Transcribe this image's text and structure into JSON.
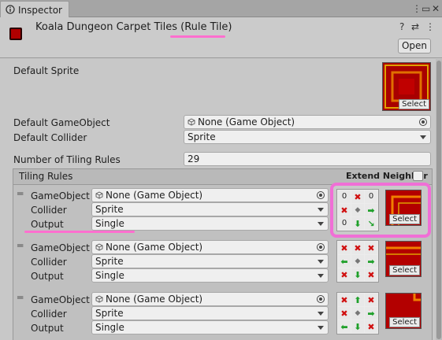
{
  "tab": {
    "label": "Inspector",
    "icon": "info-icon"
  },
  "window_controls": {
    "menu_icon": "kebab-menu-icon",
    "maximize_icon": "maximize-icon",
    "close_icon": "close-icon"
  },
  "header": {
    "title": "Koala Dungeon Carpet Tiles",
    "type_suffix": "(Rule Tile)",
    "open_label": "Open",
    "icons": [
      "help-icon",
      "preset-icon",
      "more-options-icon"
    ]
  },
  "fields": {
    "default_sprite_label": "Default Sprite",
    "default_sprite_select": "Select",
    "default_gameobject_label": "Default GameObject",
    "default_gameobject_value": "None (Game Object)",
    "default_collider_label": "Default Collider",
    "default_collider_value": "Sprite",
    "num_tiling_rules_label": "Number of Tiling Rules",
    "num_tiling_rules_value": "29"
  },
  "tiling_rules": {
    "title": "Tiling Rules",
    "extend_neighbor_label": "Extend Neighbor",
    "extend_neighbor_checked": false,
    "rules": [
      {
        "gameobject_label": "GameObject",
        "gameobject_value": "None (Game Object)",
        "collider_label": "Collider",
        "collider_value": "Sprite",
        "output_label": "Output",
        "output_value": "Single",
        "select_label": "Select",
        "grid": [
          "0",
          "x",
          "0",
          "x",
          "c",
          "a",
          "0",
          "a",
          "a-corner"
        ]
      },
      {
        "gameobject_label": "GameObject",
        "gameobject_value": "None (Game Object)",
        "collider_label": "Collider",
        "collider_value": "Sprite",
        "output_label": "Output",
        "output_value": "Single",
        "select_label": "Select",
        "grid": [
          "x",
          "x",
          "x",
          "a",
          "c",
          "a",
          "x",
          "a",
          "x"
        ]
      },
      {
        "gameobject_label": "GameObject",
        "gameobject_value": "None (Game Object)",
        "collider_label": "Collider",
        "collider_value": "Sprite",
        "output_label": "Output",
        "output_value": "Single",
        "select_label": "Select",
        "grid": [
          "x",
          "a",
          "x",
          "x",
          "c",
          "a",
          "a",
          "a",
          "x"
        ]
      }
    ]
  },
  "colors": {
    "highlight": "#f06fd6",
    "tile_red": "#b30000",
    "x_red": "#d01010",
    "arrow_green": "#1fa02a"
  }
}
